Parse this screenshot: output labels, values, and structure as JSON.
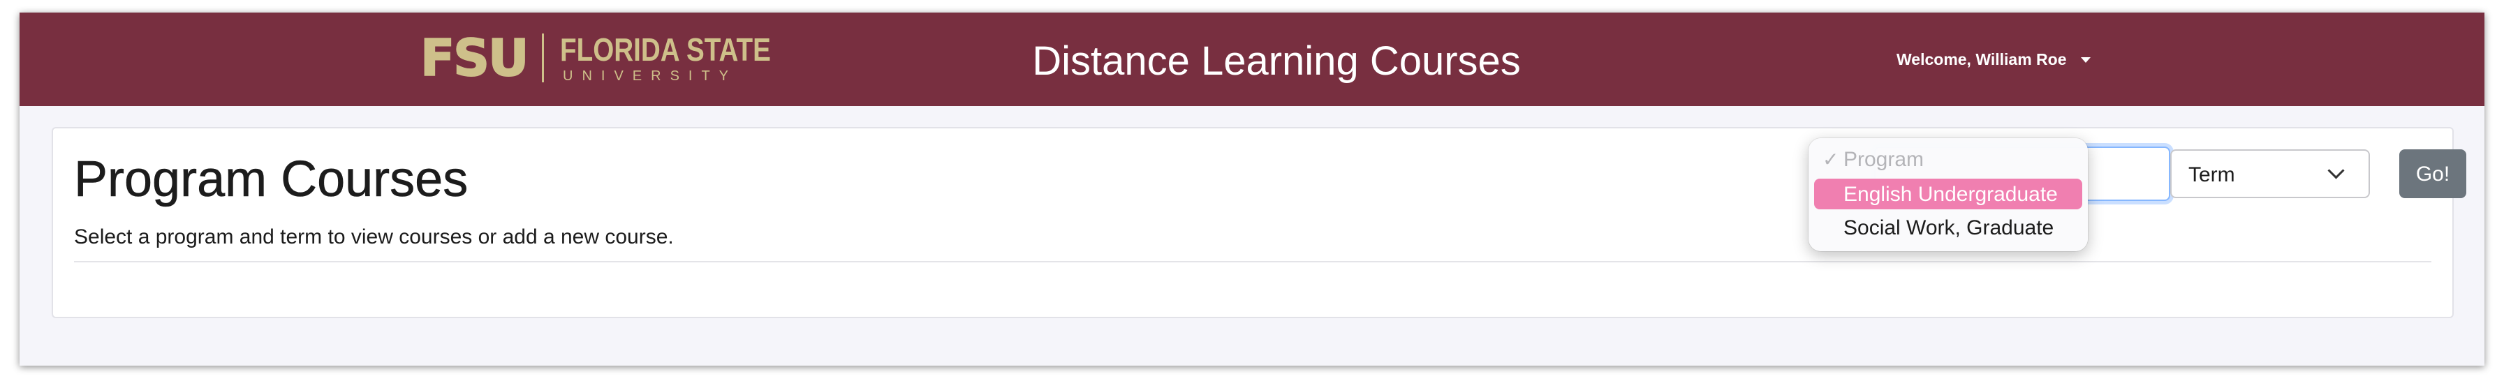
{
  "header": {
    "logo_mark": "FSU",
    "logo_name": "FLORIDA STATE",
    "logo_sub": "UNIVERSITY",
    "title": "Distance Learning Courses",
    "user_label": "Welcome, William Roe",
    "bg_color": "#782f40",
    "logo_color": "#cec08a"
  },
  "page": {
    "title": "Program Courses",
    "subtitle": "Select a program and term to view courses or add a new course."
  },
  "filters": {
    "program_dropdown": {
      "open": true,
      "options": [
        {
          "label": "Program",
          "disabled": true,
          "checked": true
        },
        {
          "label": "English Undergraduate",
          "highlighted": true
        },
        {
          "label": "Social Work, Graduate"
        }
      ]
    },
    "term_value": "Term",
    "go_label": "Go!"
  },
  "icons": {
    "checkmark": "✓",
    "user_caret": "caret-down-icon",
    "term_chevron": "chevron-down-icon"
  }
}
